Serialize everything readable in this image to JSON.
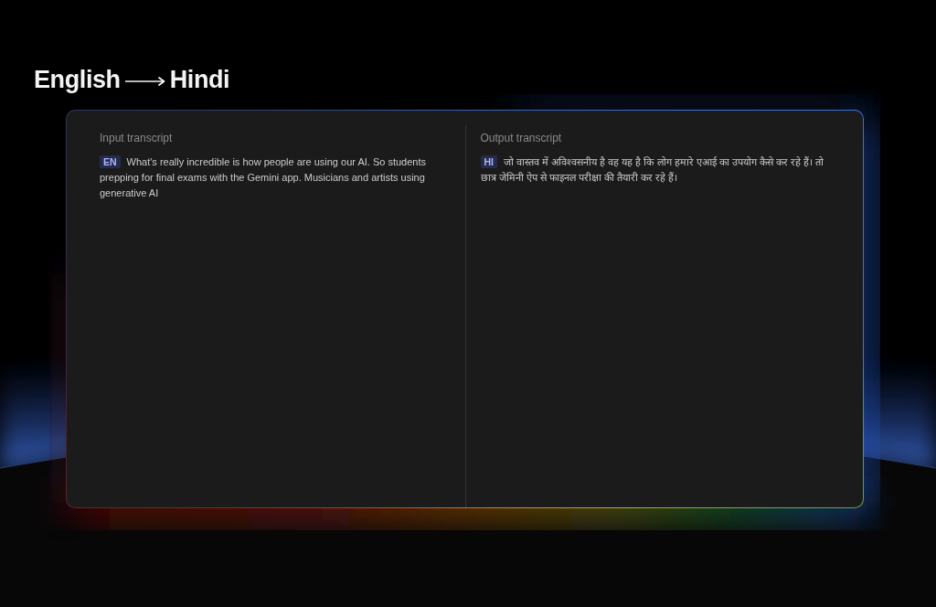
{
  "title": {
    "source_language": "English",
    "target_language": "Hindi"
  },
  "panels": [
    {
      "heading": "Input transcript",
      "language_code": "EN",
      "text": "What's really incredible is how people are using our AI. So students prepping for final exams with the Gemini app. Musicians and artists using generative AI"
    },
    {
      "heading": "Output transcript",
      "language_code": "HI",
      "text": "जो वास्तव में अविश्वसनीय है वह यह है कि लोग हमारे एआई का उपयोग कैसे कर रहे हैं। तो छात्र जेमिनी ऐप से फाइनल परीक्षा की तैयारी कर रहे हैं।"
    }
  ]
}
